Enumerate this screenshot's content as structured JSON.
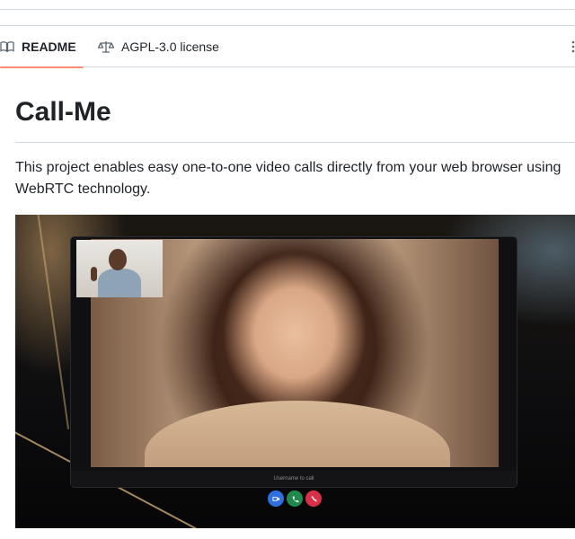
{
  "tabs": {
    "readme_label": "README",
    "license_label": "AGPL-3.0 license"
  },
  "readme": {
    "title": "Call-Me",
    "description": "This project enables easy one-to-one video calls directly from your web browser using WebRTC technology."
  },
  "preview": {
    "username_placeholder": "Username to call",
    "controls": [
      "video-icon",
      "phone-icon",
      "hangup-icon"
    ],
    "control_colors": [
      "#2f6fe0",
      "#1f8a4c",
      "#d9304a"
    ]
  },
  "colors": {
    "accent_underline": "#fd8c73",
    "border": "#d1d9e0",
    "text": "#1f2328"
  }
}
